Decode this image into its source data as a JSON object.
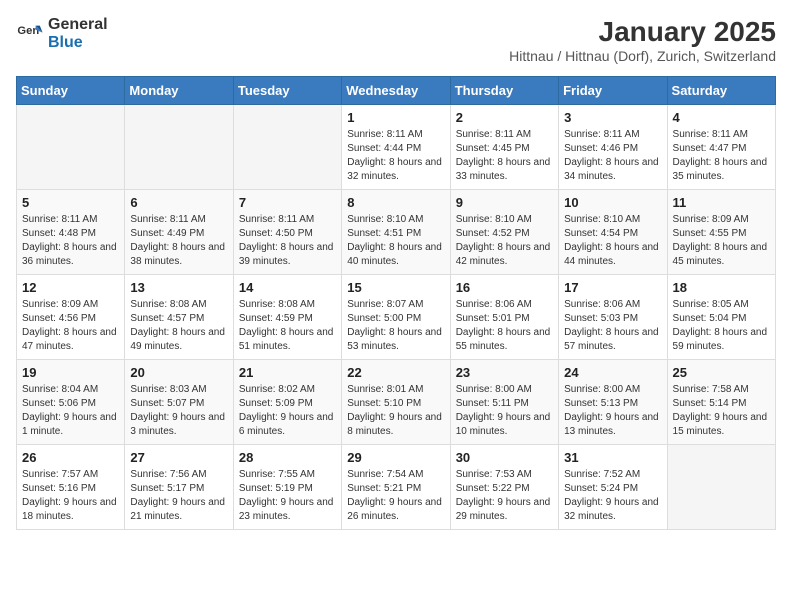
{
  "header": {
    "logo_general": "General",
    "logo_blue": "Blue",
    "title": "January 2025",
    "subtitle": "Hittnau / Hittnau (Dorf), Zurich, Switzerland"
  },
  "days_of_week": [
    "Sunday",
    "Monday",
    "Tuesday",
    "Wednesday",
    "Thursday",
    "Friday",
    "Saturday"
  ],
  "weeks": [
    {
      "days": [
        {
          "num": "",
          "info": ""
        },
        {
          "num": "",
          "info": ""
        },
        {
          "num": "",
          "info": ""
        },
        {
          "num": "1",
          "info": "Sunrise: 8:11 AM\nSunset: 4:44 PM\nDaylight: 8 hours and 32 minutes."
        },
        {
          "num": "2",
          "info": "Sunrise: 8:11 AM\nSunset: 4:45 PM\nDaylight: 8 hours and 33 minutes."
        },
        {
          "num": "3",
          "info": "Sunrise: 8:11 AM\nSunset: 4:46 PM\nDaylight: 8 hours and 34 minutes."
        },
        {
          "num": "4",
          "info": "Sunrise: 8:11 AM\nSunset: 4:47 PM\nDaylight: 8 hours and 35 minutes."
        }
      ]
    },
    {
      "days": [
        {
          "num": "5",
          "info": "Sunrise: 8:11 AM\nSunset: 4:48 PM\nDaylight: 8 hours and 36 minutes."
        },
        {
          "num": "6",
          "info": "Sunrise: 8:11 AM\nSunset: 4:49 PM\nDaylight: 8 hours and 38 minutes."
        },
        {
          "num": "7",
          "info": "Sunrise: 8:11 AM\nSunset: 4:50 PM\nDaylight: 8 hours and 39 minutes."
        },
        {
          "num": "8",
          "info": "Sunrise: 8:10 AM\nSunset: 4:51 PM\nDaylight: 8 hours and 40 minutes."
        },
        {
          "num": "9",
          "info": "Sunrise: 8:10 AM\nSunset: 4:52 PM\nDaylight: 8 hours and 42 minutes."
        },
        {
          "num": "10",
          "info": "Sunrise: 8:10 AM\nSunset: 4:54 PM\nDaylight: 8 hours and 44 minutes."
        },
        {
          "num": "11",
          "info": "Sunrise: 8:09 AM\nSunset: 4:55 PM\nDaylight: 8 hours and 45 minutes."
        }
      ]
    },
    {
      "days": [
        {
          "num": "12",
          "info": "Sunrise: 8:09 AM\nSunset: 4:56 PM\nDaylight: 8 hours and 47 minutes."
        },
        {
          "num": "13",
          "info": "Sunrise: 8:08 AM\nSunset: 4:57 PM\nDaylight: 8 hours and 49 minutes."
        },
        {
          "num": "14",
          "info": "Sunrise: 8:08 AM\nSunset: 4:59 PM\nDaylight: 8 hours and 51 minutes."
        },
        {
          "num": "15",
          "info": "Sunrise: 8:07 AM\nSunset: 5:00 PM\nDaylight: 8 hours and 53 minutes."
        },
        {
          "num": "16",
          "info": "Sunrise: 8:06 AM\nSunset: 5:01 PM\nDaylight: 8 hours and 55 minutes."
        },
        {
          "num": "17",
          "info": "Sunrise: 8:06 AM\nSunset: 5:03 PM\nDaylight: 8 hours and 57 minutes."
        },
        {
          "num": "18",
          "info": "Sunrise: 8:05 AM\nSunset: 5:04 PM\nDaylight: 8 hours and 59 minutes."
        }
      ]
    },
    {
      "days": [
        {
          "num": "19",
          "info": "Sunrise: 8:04 AM\nSunset: 5:06 PM\nDaylight: 9 hours and 1 minute."
        },
        {
          "num": "20",
          "info": "Sunrise: 8:03 AM\nSunset: 5:07 PM\nDaylight: 9 hours and 3 minutes."
        },
        {
          "num": "21",
          "info": "Sunrise: 8:02 AM\nSunset: 5:09 PM\nDaylight: 9 hours and 6 minutes."
        },
        {
          "num": "22",
          "info": "Sunrise: 8:01 AM\nSunset: 5:10 PM\nDaylight: 9 hours and 8 minutes."
        },
        {
          "num": "23",
          "info": "Sunrise: 8:00 AM\nSunset: 5:11 PM\nDaylight: 9 hours and 10 minutes."
        },
        {
          "num": "24",
          "info": "Sunrise: 8:00 AM\nSunset: 5:13 PM\nDaylight: 9 hours and 13 minutes."
        },
        {
          "num": "25",
          "info": "Sunrise: 7:58 AM\nSunset: 5:14 PM\nDaylight: 9 hours and 15 minutes."
        }
      ]
    },
    {
      "days": [
        {
          "num": "26",
          "info": "Sunrise: 7:57 AM\nSunset: 5:16 PM\nDaylight: 9 hours and 18 minutes."
        },
        {
          "num": "27",
          "info": "Sunrise: 7:56 AM\nSunset: 5:17 PM\nDaylight: 9 hours and 21 minutes."
        },
        {
          "num": "28",
          "info": "Sunrise: 7:55 AM\nSunset: 5:19 PM\nDaylight: 9 hours and 23 minutes."
        },
        {
          "num": "29",
          "info": "Sunrise: 7:54 AM\nSunset: 5:21 PM\nDaylight: 9 hours and 26 minutes."
        },
        {
          "num": "30",
          "info": "Sunrise: 7:53 AM\nSunset: 5:22 PM\nDaylight: 9 hours and 29 minutes."
        },
        {
          "num": "31",
          "info": "Sunrise: 7:52 AM\nSunset: 5:24 PM\nDaylight: 9 hours and 32 minutes."
        },
        {
          "num": "",
          "info": ""
        }
      ]
    }
  ]
}
